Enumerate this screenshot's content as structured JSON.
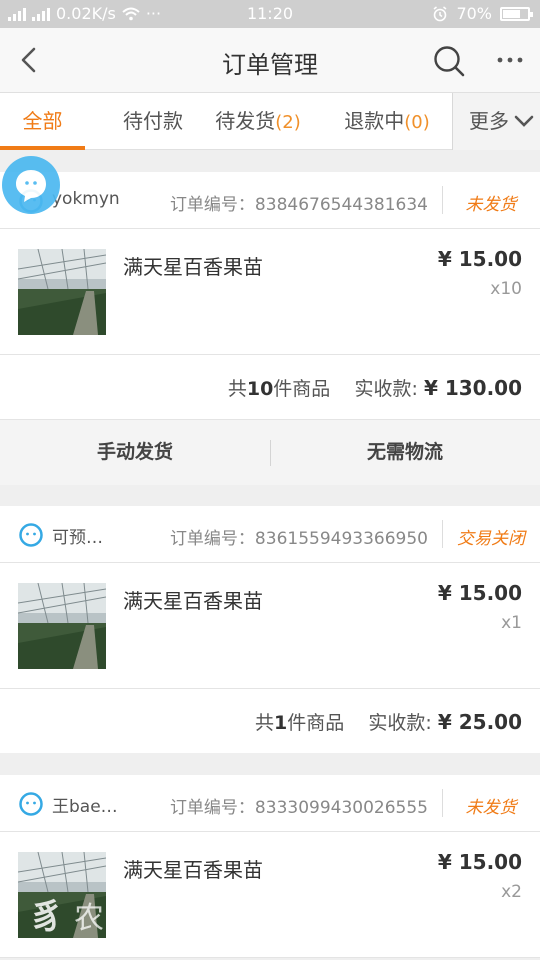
{
  "status_bar": {
    "left": "0.02K/s",
    "time": "11:20",
    "battery": "70%",
    "battery_level": 0.7,
    "left_icons": [
      "signal-icon",
      "signal-icon",
      "wifi-icon",
      "dots-icon"
    ],
    "right_icons": [
      "alarm-icon",
      "battery-icon"
    ]
  },
  "nav": {
    "title": "订单管理",
    "icons": [
      "back-icon",
      "search-icon",
      "more-icon"
    ]
  },
  "tabs": {
    "items": [
      {
        "label": "全部",
        "count": ""
      },
      {
        "label": "待付款",
        "count": ""
      },
      {
        "label": "待发货",
        "count": "(2)"
      },
      {
        "label": "退款中",
        "count": "(0)"
      }
    ],
    "active": 0,
    "more_label": "更多"
  },
  "orders": [
    {
      "buyer": "yokmyn",
      "order_no": "订单编号：8384676544381634",
      "status": "未发货",
      "product": "满天星百香果苗",
      "price": "¥ 15.00",
      "qty": "x10",
      "summary_prefix": "共",
      "summary_count": "10",
      "summary_suffix": "件商品",
      "received_label": "实收款: ",
      "received_amount": "¥ 130.00",
      "actions": [
        "手动发货",
        "无需物流"
      ]
    },
    {
      "buyer": "可预…",
      "order_no": "订单编号：8361559493366950",
      "status": "交易关闭",
      "product": "满天星百香果苗",
      "price": "¥ 15.00",
      "qty": "x1",
      "summary_prefix": "共",
      "summary_count": "1",
      "summary_suffix": "件商品",
      "received_label": "实收款: ",
      "received_amount": "¥ 25.00"
    },
    {
      "buyer": "王bae…",
      "order_no": "订单编号：8333099430026555",
      "status": "未发货",
      "product": "满天星百香果苗",
      "price": "¥ 15.00",
      "qty": "x2"
    }
  ],
  "colors": {
    "accent": "#f07b16",
    "tab_count": "#f0902a",
    "float_button": "#4bb8f0",
    "status_bar": "#cfcfcf"
  },
  "watermark": "农"
}
